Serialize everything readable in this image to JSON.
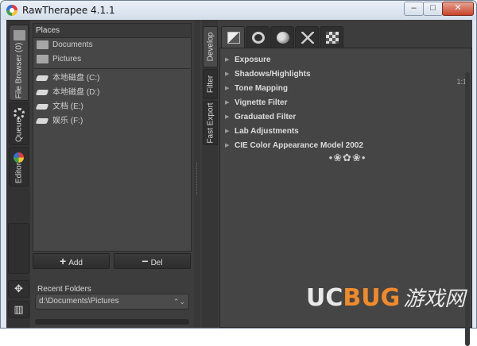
{
  "window": {
    "title": "RawTherapee 4.1.1",
    "minimize": "–",
    "maximize": "□",
    "close": "✕"
  },
  "left_tabs": [
    {
      "label": "File Browser (0)",
      "icon": "folder-icon"
    },
    {
      "label": "Queue",
      "icon": "gear-icon"
    },
    {
      "label": "Editor",
      "icon": "color-wheel-icon"
    }
  ],
  "left_bottom": {
    "move_icon": "✥",
    "filmstrip_icon": "▥"
  },
  "places": {
    "header": "Places",
    "folders": [
      {
        "label": "Documents"
      },
      {
        "label": "Pictures"
      }
    ],
    "drives": [
      {
        "label": "本地磁盘 (C:)"
      },
      {
        "label": "本地磁盘 (D:)"
      },
      {
        "label": "文档 (E:)"
      },
      {
        "label": "娱乐 (F:)"
      }
    ]
  },
  "buttons": {
    "add_label": "Add",
    "add_symbol": "+",
    "del_label": "Del",
    "del_symbol": "−"
  },
  "recent": {
    "label": "Recent Folders",
    "value": "d:\\Documents\\Pictures",
    "arrows": "⌃⌄"
  },
  "tool_side_tabs": [
    {
      "label": "Develop"
    },
    {
      "label": "Filter"
    },
    {
      "label": "Fast Export"
    }
  ],
  "tool_tabs": [
    {
      "icon": "exposure-icon"
    },
    {
      "icon": "detail-icon"
    },
    {
      "icon": "color-icon"
    },
    {
      "icon": "transform-icon"
    },
    {
      "icon": "raw-icon"
    }
  ],
  "tools": [
    {
      "label": "Exposure"
    },
    {
      "label": "Shadows/Highlights"
    },
    {
      "label": "Tone Mapping"
    },
    {
      "label": "Vignette Filter"
    },
    {
      "label": "Graduated Filter"
    },
    {
      "label": "Lab Adjustments"
    },
    {
      "label": "CIE Color Appearance Model 2002"
    }
  ],
  "tool_arrow": "▶",
  "zoom_readout": "1:1",
  "ornament": "•❀✿❀•",
  "watermark": {
    "uc": "UC",
    "bug": "BUG",
    "cn": "游戏网"
  },
  "colors": {
    "panel_bg": "#3d3d3d",
    "accent_orange": "#f08a2a"
  }
}
